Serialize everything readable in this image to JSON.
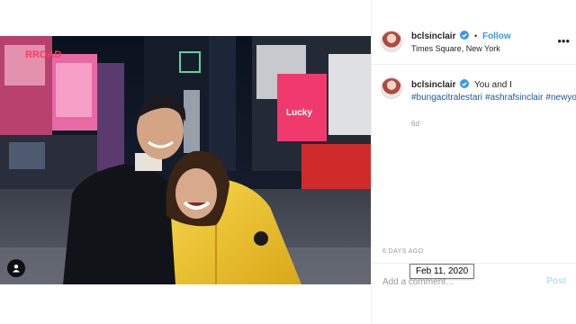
{
  "post": {
    "username": "bclsinclair",
    "follow_label": "Follow",
    "location": "Times Square, New York",
    "caption": {
      "username": "bclsinclair",
      "text": "You and I",
      "hashtags": [
        "#bungacitralestari",
        "#ashrafsinclair",
        "#newyork"
      ]
    },
    "age": "6d",
    "timestamp": "6 DAYS AGO",
    "tooltip": "Feb 11, 2020",
    "comment_placeholder": "Add a comment…",
    "post_label": "Post"
  },
  "photo": {
    "sign_text": "Lucky"
  },
  "colors": {
    "follow": "#3897f0",
    "verified": "#3897f0",
    "hashtag": "#1a5a9a",
    "post_disabled": "#b2dffc"
  },
  "icons": [
    "verified-badge-icon",
    "more-options-icon",
    "user-tag-icon"
  ]
}
